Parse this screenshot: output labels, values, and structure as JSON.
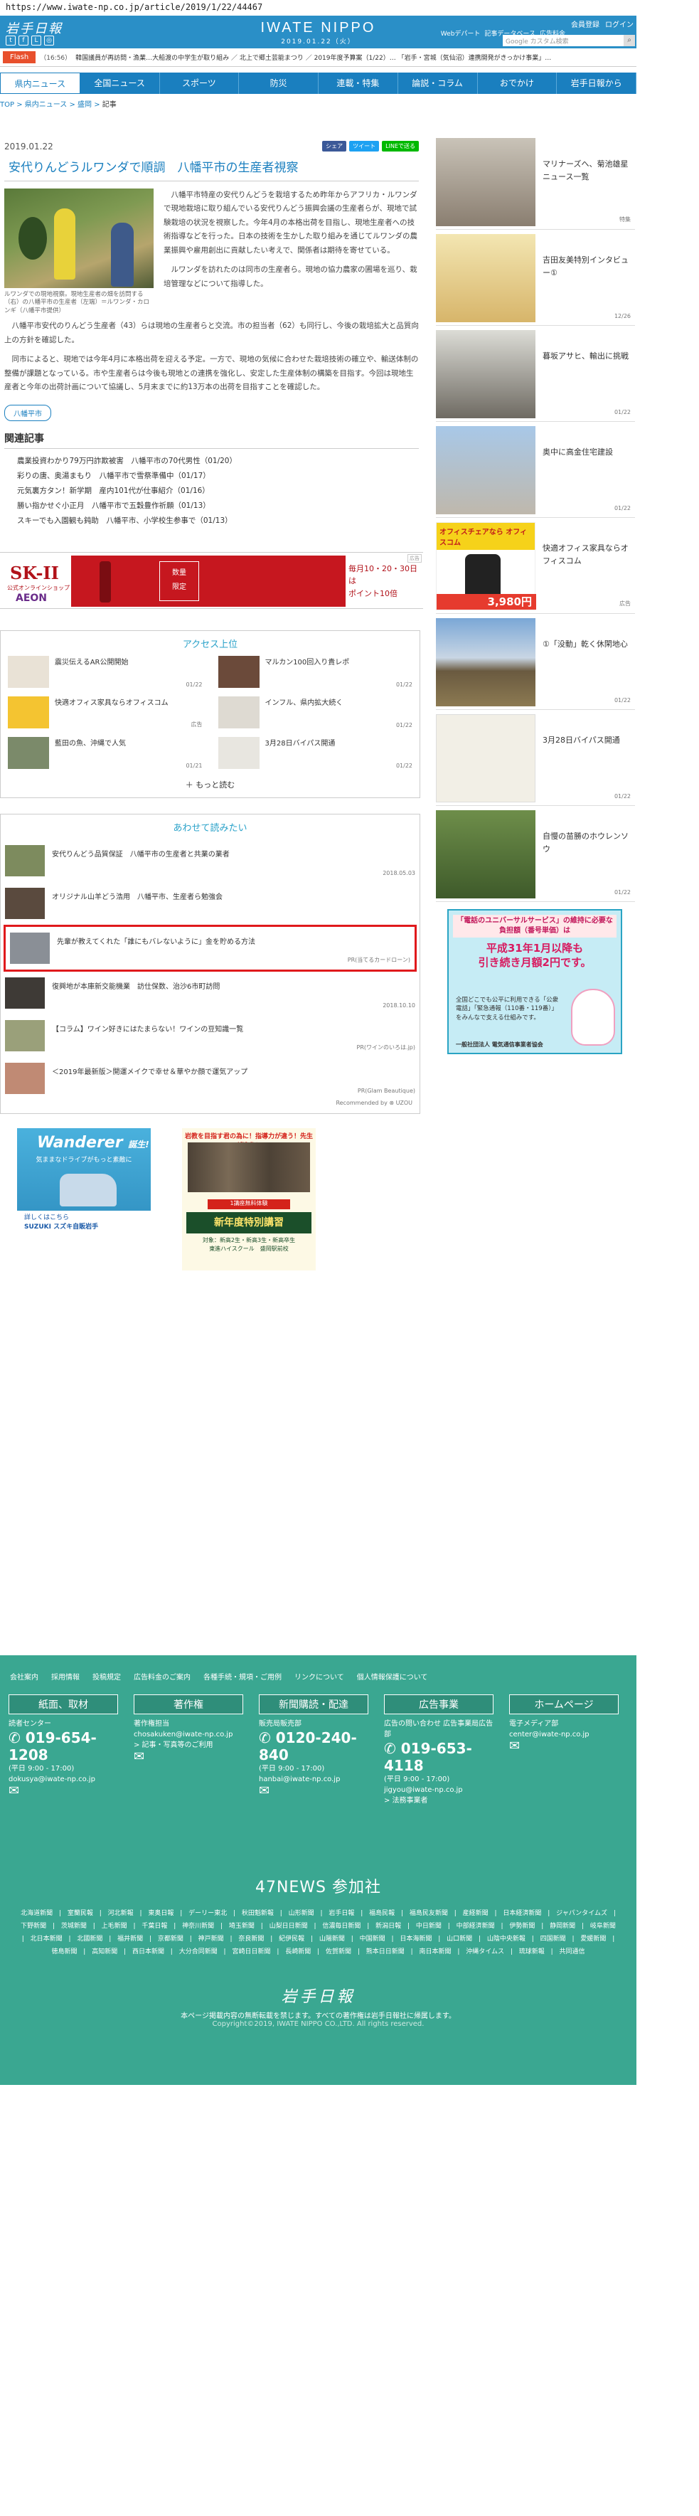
{
  "browser": {
    "url": "https://www.iwate-np.co.jp/article/2019/1/22/44467"
  },
  "header": {
    "logo": "岩手日報",
    "brand": "IWATE NIPPO",
    "date": "2019.01.22（火）",
    "user_links": [
      "会員登録",
      "ログイン"
    ],
    "sub_links": [
      "Webデパート",
      "記事データベース",
      "広告料金"
    ],
    "search_placeholder": "Google カスタム検索",
    "social_icons": [
      "twitter-icon",
      "facebook-icon",
      "line-icon",
      "instagram-icon"
    ]
  },
  "flash": {
    "label": "Flash",
    "time": "（16:56）",
    "text": "韓国議員が再訪問・漁業…大船渡の中学生が取り組み ／ 北上で郷土芸能まつり ／ 2019年度予算案（1/22）… 「岩手・宮城（気仙沼）連携開発がきっかけ事業」…"
  },
  "nav": [
    "県内ニュース",
    "全国ニュース",
    "スポーツ",
    "防災",
    "連載・特集",
    "論説・コラム",
    "おでかけ",
    "岩手日報から"
  ],
  "breadcrumb": [
    "TOP",
    "県内ニュース",
    "盛岡",
    "記事"
  ],
  "article": {
    "date": "2019.01.22",
    "share": [
      "シェア",
      "ツイート",
      "LINEで送る"
    ],
    "title": "安代りんどうルワンダで順調　八幡平市の生産者視察",
    "caption": "ルワンダでの現地視察。現地生産者の畑を訪問する（右）の八幡平市の生産者（左端）＝ルワンダ・カロンギ（八幡平市提供）",
    "lead": "八幡平市特産の安代りんどうを栽培するため昨年からアフリカ・ルワンダで現地栽培に取り組んでいる安代りんどう振興会議の生産者らが、現地で試験栽培の状況を視察した。今年4月の本格出荷を目指し、現地生産者への技術指導などを行った。日本の技術を生かした取り組みを通じてルワンダの農業振興や雇用創出に貢献したい考えで、関係者は期待を寄せている。",
    "lead2": "ルワンダを訪れたのは同市の生産者ら。現地の協力農家の圃場を巡り、栽培管理などについて指導した。",
    "paragraphs": [
      "八幡平市安代のりんどう生産者（43）らは現地の生産者らと交流。市の担当者（62）も同行し、今後の栽培拡大と品質向上の方針を確認した。",
      "同市によると、現地では今年4月に本格出荷を迎える予定。一方で、現地の気候に合わせた栽培技術の確立や、輸送体制の整備が課題となっている。市や生産者らは今後も現地との連携を強化し、安定した生産体制の構築を目指す。今回は現地生産者と今年の出荷計画について協議し、5月末までに約13万本の出荷を目指すことを確認した。"
    ],
    "tag": "八幡平市"
  },
  "related": {
    "heading": "関連記事",
    "items": [
      "農業投資わかり79万円詐欺被害　八幡平市の70代男性（01/20）",
      "彩りの唐、奥湯まもり　八幡平市で雪祭準備中（01/17）",
      "元気裏方タン！新学期　産内101代が仕事紹介（01/16）",
      "勝い指かせぐ小正月　八幡平市で五穀豊作祈願（01/13）",
      "スキーでも入園観も鈍助　八幡平市、小学校生参事で（01/13）"
    ]
  },
  "banner_ad": {
    "brand": "SK-II",
    "brand_sub": "公式オンラインショップ",
    "store": "AEON",
    "box": [
      "数量",
      "限定"
    ],
    "promo": [
      "毎月10・20・30日は",
      "ポイント10倍"
    ],
    "pr": "広告"
  },
  "access": {
    "heading": "アクセス上位",
    "items": [
      {
        "text": "震災伝えるAR公開開始",
        "date": "01/22"
      },
      {
        "text": "マルカン100回入り貴レポ",
        "date": "01/22"
      },
      {
        "text": "快適オフィス家具ならオフィスコム",
        "date": "広告"
      },
      {
        "text": "インフル、県内拡大続く",
        "date": "01/22"
      },
      {
        "text": "藍田の魚、沖縄で人気",
        "date": "01/21"
      },
      {
        "text": "3月28日バイパス開通",
        "date": "01/22"
      }
    ],
    "more": "もっと読む"
  },
  "also_read": {
    "heading": "あわせて読みたい",
    "items": [
      {
        "text": "安代りんどう品質保証　八幡平市の生産者と共業の業者",
        "date": "2018.05.03"
      },
      {
        "text": "オリジナル山羊どう浩用　八幡平市、生産者ら勉強会",
        "date": ""
      },
      {
        "text": "先輩が教えてくれた「誰にもバレないように」金を貯める方法",
        "date": "PR(当てるカードローン)"
      },
      {
        "text": "復興地が本庫新交能機業　訪仕保数、治沙6市町訪問",
        "date": "2018.10.10"
      },
      {
        "text": "【コラム】ワイン好きにはたまらない！ワインの豆知識一覧",
        "date": "PR(ワインのいろは.jp)"
      },
      {
        "text": "＜2019年最新版＞開運メイクで幸せ＆華やか顔で運気アップ",
        "date": "PR(Glam Beautique)"
      }
    ],
    "recommended_by": "Recommended by ⊗ UZOU"
  },
  "bottom_ads": {
    "suzuki_title": "Wanderer",
    "suzuki_tag": "誕生!",
    "suzuki_sub": "気ままなドライブがもっと素敵に",
    "suzuki_cta": "詳しくはこちら",
    "suzuki_brand": "SUZUKI スズキ自販岩手",
    "school_top": "岩教を目指す君の為に！指導力が違う！先生が違う！",
    "school_ribbon": "1講座無料体験",
    "school_big": "新年度特別講習",
    "school_sub": [
      "対象：新高2生・新高3生・新高卒生",
      "東進ハイスクール　盛岡駅前校"
    ]
  },
  "sidebar": {
    "items": [
      {
        "text": "マリナーズへ、菊池雄星ニュース一覧",
        "date": "特集"
      },
      {
        "text": "吉田友美特別インタビュー①",
        "date": "12/26"
      },
      {
        "text": "暮坂アサヒ、輸出に挑戦",
        "date": "01/22"
      },
      {
        "text": "奥中に高金住宅建設",
        "date": "01/22"
      },
      {
        "text": "快適オフィス家具ならオフィスコム",
        "date": "広告"
      },
      {
        "text": "①「没動」乾く休閑地心",
        "date": "01/22"
      },
      {
        "text": "3月28日バイパス開通",
        "date": "01/22"
      },
      {
        "text": "自慢の苗勝のホウレンソウ",
        "date": "01/22"
      }
    ],
    "ad_price": "3,980円",
    "ad_office": "オフィスチェアなら オフィスコム",
    "uad": {
      "title": "「電話のユニバーサルサービス」の維持に必要な負担額（番号単価）は",
      "big": [
        "平成31年1月以降も",
        "引き続き月額2円です。"
      ],
      "body": "全国どこでも公平に利用できる「公衆電話」「緊急通報（110番・119番）」をみんなで支える仕組みです。",
      "org": "一般社団法人 電気通信事業者協会"
    }
  },
  "footer": {
    "links": [
      "会社案内",
      "採用情報",
      "投稿規定",
      "広告料金のご案内",
      "各種手続・規項・ご用例",
      "リンクについて",
      "個人情報保護について"
    ],
    "cols": [
      {
        "head": "紙面、取材",
        "label": "読者センター",
        "tel": "019-654-1208",
        "hours": "(平日 9:00 - 17:00)",
        "mail": "dokusya@iwate-np.co.jp",
        "extra": ""
      },
      {
        "head": "著作権",
        "label": "著作権担当",
        "tel": "",
        "hours": "",
        "mail": "chosakuken@iwate-np.co.jp",
        "extra": "> 記事・写真等のご利用"
      },
      {
        "head": "新聞購読・配達",
        "label": "販売局販売部",
        "tel": "0120-240-840",
        "hours": "(平日 9:00 - 17:00)",
        "mail": "hanbai@iwate-np.co.jp",
        "extra": ""
      },
      {
        "head": "広告事業",
        "label": "広告の問い合わせ 広告事業局広告部",
        "tel": "019-653-4118",
        "hours": "(平日 9:00 - 17:00)",
        "mail": "jigyou@iwate-np.co.jp",
        "extra": "> 法務事業者"
      },
      {
        "head": "ホームページ",
        "label": "電子メディア部",
        "tel": "",
        "hours": "",
        "mail": "center@iwate-np.co.jp",
        "extra": ""
      }
    ],
    "f47": "47NEWS 参加社",
    "papers": "北海道新聞 | 室蘭民報 | 河北新報 | 東奥日報 | デーリー東北 | 秋田魁新報 | 山形新聞 | 岩手日報 | 福島民報 | 福島民友新聞 | 産経新聞 | 日本経済新聞 | ジャパンタイムズ | 下野新聞 | 茨城新聞 | 上毛新聞 | 千葉日報 | 神奈川新聞 | 埼玉新聞 | 山梨日日新聞 | 信濃毎日新聞 | 新潟日報 | 中日新聞 | 中部経済新聞 | 伊勢新聞 | 静岡新聞 | 岐阜新聞 | 北日本新聞 | 北國新聞 | 福井新聞 | 京都新聞 | 神戸新聞 | 奈良新聞 | 紀伊民報 | 山陽新聞 | 中国新聞 | 日本海新聞 | 山口新聞 | 山陰中央新報 | 四国新聞 | 愛媛新聞 | 徳島新聞 | 高知新聞 | 西日本新聞 | 大分合同新聞 | 宮崎日日新聞 | 長崎新聞 | 佐賀新聞 | 熊本日日新聞 | 南日本新聞 | 沖縄タイムス | 琉球新報 | 共同通信",
    "logo": "岩手日報",
    "notice": "本ページ掲載内容の無断転載を禁じます。すべての著作権は岩手日報社に帰属します。",
    "copyright": "Copyright©2019, IWATE NIPPO CO.,LTD. All rights reserved."
  }
}
